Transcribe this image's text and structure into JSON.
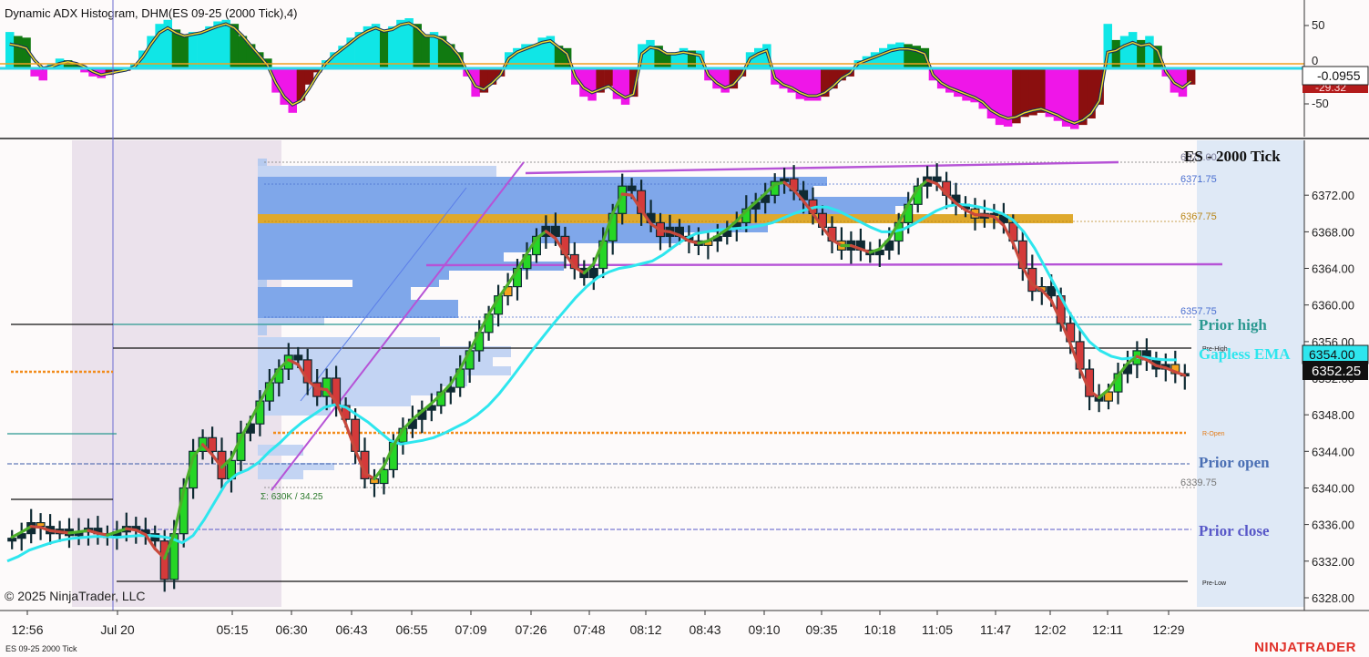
{
  "window": {
    "indicator_title": "Dynamic ADX Histogram, DHM(ES 09-25 (2000 Tick),4)",
    "chart_title": "ES - 2000 Tick",
    "copyright": "© 2025 NinjaTrader, LLC",
    "instrument_footer": "ES 09-25 2000 Tick",
    "brand": "NINJATRADER"
  },
  "colors": {
    "background": "#fdfafa",
    "overnight_shade": "#ebe2ec",
    "right_panel": "#dfe9f6",
    "ema_gapless": "#2ee6ee",
    "fast_avg_up": "#4caf2a",
    "fast_avg_down": "#c8493c",
    "profile": "#7fa7ea",
    "profile_light": "#c3d4f3",
    "poc": "#dfa92d",
    "channel": "#b653d6",
    "hist_cyan": "#10e6e6",
    "hist_green": "#117a11",
    "hist_magenta": "#ef16e8",
    "hist_darkred": "#8b0f0f"
  },
  "chart_data": [
    {
      "type": "bar",
      "panel": "indicator",
      "title": "Dynamic ADX Histogram, DHM(ES 09-25 (2000 Tick),4)",
      "ylim": [
        -80,
        80
      ],
      "yticks": [
        50,
        0,
        -50
      ],
      "y_axis_marker": "0",
      "last_value": "-0.0955",
      "secondary_label": "-29.32",
      "values": [
        45,
        40,
        38,
        -10,
        -15,
        5,
        12,
        10,
        5,
        -5,
        -10,
        -12,
        -8,
        -5,
        -3,
        6,
        22,
        40,
        55,
        60,
        48,
        42,
        45,
        45,
        52,
        58,
        60,
        55,
        40,
        30,
        20,
        12,
        -30,
        -45,
        -55,
        -40,
        -20,
        -5,
        10,
        20,
        28,
        38,
        45,
        52,
        55,
        48,
        52,
        60,
        62,
        55,
        42,
        45,
        40,
        30,
        20,
        -10,
        -35,
        -30,
        -20,
        -10,
        20,
        25,
        30,
        30,
        38,
        40,
        28,
        25,
        -20,
        -35,
        -40,
        -30,
        -22,
        -38,
        -45,
        -35,
        30,
        35,
        28,
        18,
        20,
        25,
        22,
        22,
        -15,
        -25,
        -30,
        -25,
        -10,
        20,
        25,
        30,
        -20,
        -25,
        -30,
        -38,
        -40,
        -40,
        -35,
        -25,
        -15,
        -10,
        10,
        15,
        20,
        25,
        30,
        32,
        30,
        28,
        25,
        -15,
        -25,
        -30,
        -35,
        -40,
        -42,
        -50,
        -62,
        -70,
        -72,
        -68,
        -60,
        -58,
        -55,
        -60,
        -65,
        -72,
        -75,
        -70,
        -62,
        -45,
        55,
        35,
        40,
        45,
        35,
        40,
        28,
        -10,
        -30,
        -35,
        -20
      ],
      "fast_line": [
        30,
        28,
        25,
        10,
        0,
        2,
        6,
        8,
        6,
        2,
        -4,
        -8,
        -6,
        -4,
        -2,
        2,
        14,
        30,
        44,
        50,
        44,
        40,
        42,
        44,
        48,
        52,
        55,
        50,
        40,
        28,
        16,
        4,
        -18,
        -35,
        -45,
        -40,
        -25,
        -8,
        6,
        16,
        24,
        32,
        40,
        46,
        50,
        46,
        48,
        54,
        56,
        50,
        40,
        40,
        36,
        28,
        16,
        -4,
        -22,
        -26,
        -18,
        -8,
        12,
        20,
        24,
        28,
        32,
        34,
        26,
        18,
        -10,
        -24,
        -30,
        -26,
        -22,
        -30,
        -36,
        -32,
        18,
        26,
        24,
        18,
        18,
        20,
        18,
        16,
        -8,
        -18,
        -24,
        -20,
        -8,
        12,
        18,
        22,
        -12,
        -20,
        -24,
        -30,
        -34,
        -34,
        -30,
        -22,
        -12,
        -6,
        6,
        10,
        14,
        18,
        22,
        24,
        24,
        22,
        18,
        -8,
        -18,
        -24,
        -28,
        -32,
        -36,
        -42,
        -52,
        -58,
        -62,
        -60,
        -55,
        -52,
        -50,
        -54,
        -58,
        -64,
        -68,
        -64,
        -56,
        -40,
        20,
        22,
        28,
        32,
        28,
        30,
        22,
        -4,
        -18,
        -24,
        -16
      ]
    },
    {
      "type": "candlestick",
      "panel": "price",
      "title": "ES - 2000 Tick",
      "ylabel": "",
      "ylim": [
        6327,
        6378
      ],
      "yticks": [
        6372,
        6368,
        6364,
        6360,
        6356,
        6352,
        6348,
        6344,
        6340,
        6336,
        6332,
        6328
      ],
      "last_price": "6352.25",
      "ema_value_tag": "6354.00",
      "xticks": [
        "12:56",
        "Jul 20",
        "05:15",
        "06:30",
        "06:43",
        "06:55",
        "07:09",
        "07:26",
        "07:48",
        "08:12",
        "08:43",
        "09:10",
        "09:35",
        "10:18",
        "11:05",
        "11:47",
        "12:02",
        "12:11",
        "12:29"
      ],
      "close_path": [
        6334.5,
        6335,
        6336.2,
        6335.8,
        6335,
        6335.5,
        6334.8,
        6335.2,
        6335.6,
        6335,
        6334.6,
        6335.2,
        6335.8,
        6335.4,
        6335,
        6334.2,
        6330,
        6335,
        6340,
        6344,
        6345.5,
        6344,
        6341,
        6343,
        6346,
        6347,
        6349.5,
        6351.5,
        6353,
        6354.5,
        6354,
        6351.5,
        6350,
        6352,
        6349,
        6347.5,
        6344,
        6341,
        6340.5,
        6342,
        6345,
        6346.5,
        6347.5,
        6348.5,
        6349,
        6350.5,
        6351,
        6353,
        6355,
        6357,
        6359,
        6361,
        6362,
        6364,
        6365.5,
        6367.5,
        6368.6,
        6367.5,
        6365.5,
        6364,
        6363,
        6364,
        6367,
        6370,
        6373,
        6372.5,
        6370,
        6369,
        6367.5,
        6368.5,
        6367.5,
        6367,
        6366.5,
        6367,
        6367.5,
        6368.3,
        6369,
        6370.5,
        6371.2,
        6372,
        6373.5,
        6373.8,
        6372.5,
        6371.5,
        6370,
        6368.5,
        6367,
        6366,
        6367,
        6366,
        6365.5,
        6366,
        6367,
        6369,
        6371,
        6373,
        6374,
        6373.5,
        6372,
        6371,
        6370.5,
        6369.5,
        6370,
        6369.8,
        6369,
        6367,
        6364,
        6361.5,
        6362,
        6361,
        6358,
        6356,
        6353,
        6350,
        6349.5,
        6350.5,
        6352.5,
        6353.5,
        6355,
        6354,
        6353,
        6353.5,
        6352.5,
        6352.25
      ],
      "gapless_ema": [
        6332,
        6332.5,
        6333.2,
        6333.6,
        6334,
        6334.3,
        6334.5,
        6334.6,
        6334.7,
        6334.7,
        6334.6,
        6334.7,
        6334.8,
        6334.8,
        6334.7,
        6334.5,
        6334,
        6334.8,
        6336.5,
        6338.5,
        6340.5,
        6341.5,
        6342,
        6342.8,
        6344,
        6345,
        6346.2,
        6347.2,
        6348,
        6348.8,
        6349.1,
        6348.8,
        6348,
        6347.2,
        6346.2,
        6345.2,
        6344.8,
        6345,
        6345.2,
        6345.5,
        6346,
        6346.6,
        6347.2,
        6348,
        6349,
        6350.3,
        6351.8,
        6353.4,
        6355,
        6356.5,
        6358,
        6359.4,
        6360.8,
        6362,
        6363,
        6363.6,
        6364,
        6364.2,
        6364.5,
        6364.8,
        6365.5,
        6366.4,
        6367.2,
        6367.8,
        6368,
        6368.2,
        6368.3,
        6368.4,
        6368.5,
        6368.7,
        6369,
        6369.5,
        6370,
        6370.4,
        6370.7,
        6370.7,
        6370.3,
        6369.7,
        6369.1,
        6368.5,
        6368,
        6368,
        6368.3,
        6368.9,
        6369.6,
        6370.3,
        6370.8,
        6371,
        6370.9,
        6370.7,
        6370.4,
        6370,
        6369.3,
        6368,
        6366.2,
        6364,
        6361.8,
        6359.5,
        6357.6,
        6356,
        6355,
        6354.4,
        6354.1,
        6354.2,
        6354.3,
        6354.1,
        6354,
        6354
      ],
      "levels": {
        "prior_high": {
          "label": "Prior high",
          "value": 6356.8
        },
        "prior_open": {
          "label": "Prior open",
          "value": 6342.3
        },
        "prior_close": {
          "label": "Prior close",
          "value": 6335
        },
        "pre_high": {
          "label": "Pre-High",
          "value": 6354.3
        },
        "pre_low": {
          "label": "Pre-Low",
          "value": 6329.5
        },
        "r_open": {
          "label": "R-Open",
          "value": 6345.5
        },
        "poc": {
          "label": "6367.75",
          "value": 6368.2
        },
        "va_high": {
          "label": "6371.75",
          "value": 6371.75
        },
        "va_low": {
          "label": "6357.75",
          "value": 6357.75
        },
        "profile_low": {
          "label": "6339.75",
          "value": 6339.75
        },
        "profile_top": {
          "label": "6375.00",
          "value": 6375
        }
      },
      "volume_summary": "Σ: 630K / 34.25",
      "gapless_ema_label": "Gapless EMA"
    }
  ]
}
